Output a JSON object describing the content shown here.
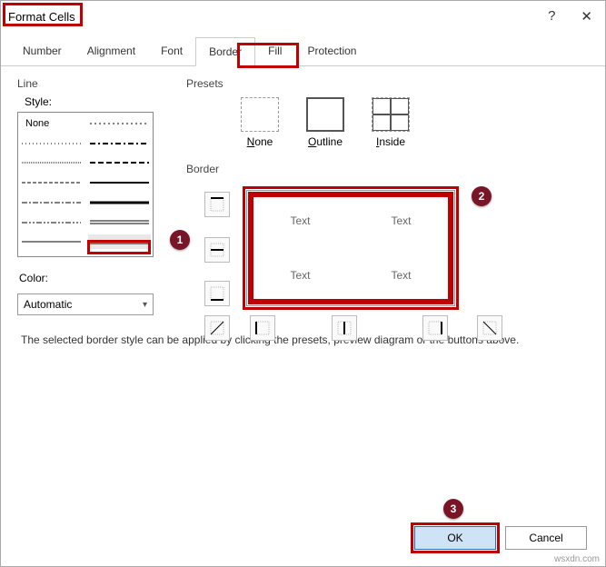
{
  "window": {
    "title": "Format Cells"
  },
  "titlebar": {
    "help": "?",
    "close": "✕"
  },
  "tabs": [
    "Number",
    "Alignment",
    "Font",
    "Border",
    "Fill",
    "Protection"
  ],
  "active_tab": "Border",
  "line": {
    "section": "Line",
    "style_label": "Style:",
    "none": "None",
    "color_label": "Color:",
    "color_value": "Automatic"
  },
  "presets": {
    "section": "Presets",
    "items": [
      {
        "id": "none",
        "label": "None"
      },
      {
        "id": "outline",
        "label": "Outline"
      },
      {
        "id": "inside",
        "label": "Inside"
      }
    ]
  },
  "border": {
    "section": "Border",
    "preview_text": "Text"
  },
  "description": "The selected border style can be applied by clicking the presets, preview diagram or the buttons above.",
  "buttons": {
    "ok": "OK",
    "cancel": "Cancel"
  },
  "callouts": {
    "style": "1",
    "preview": "2",
    "ok": "3"
  },
  "watermark": "wsxdn.com"
}
